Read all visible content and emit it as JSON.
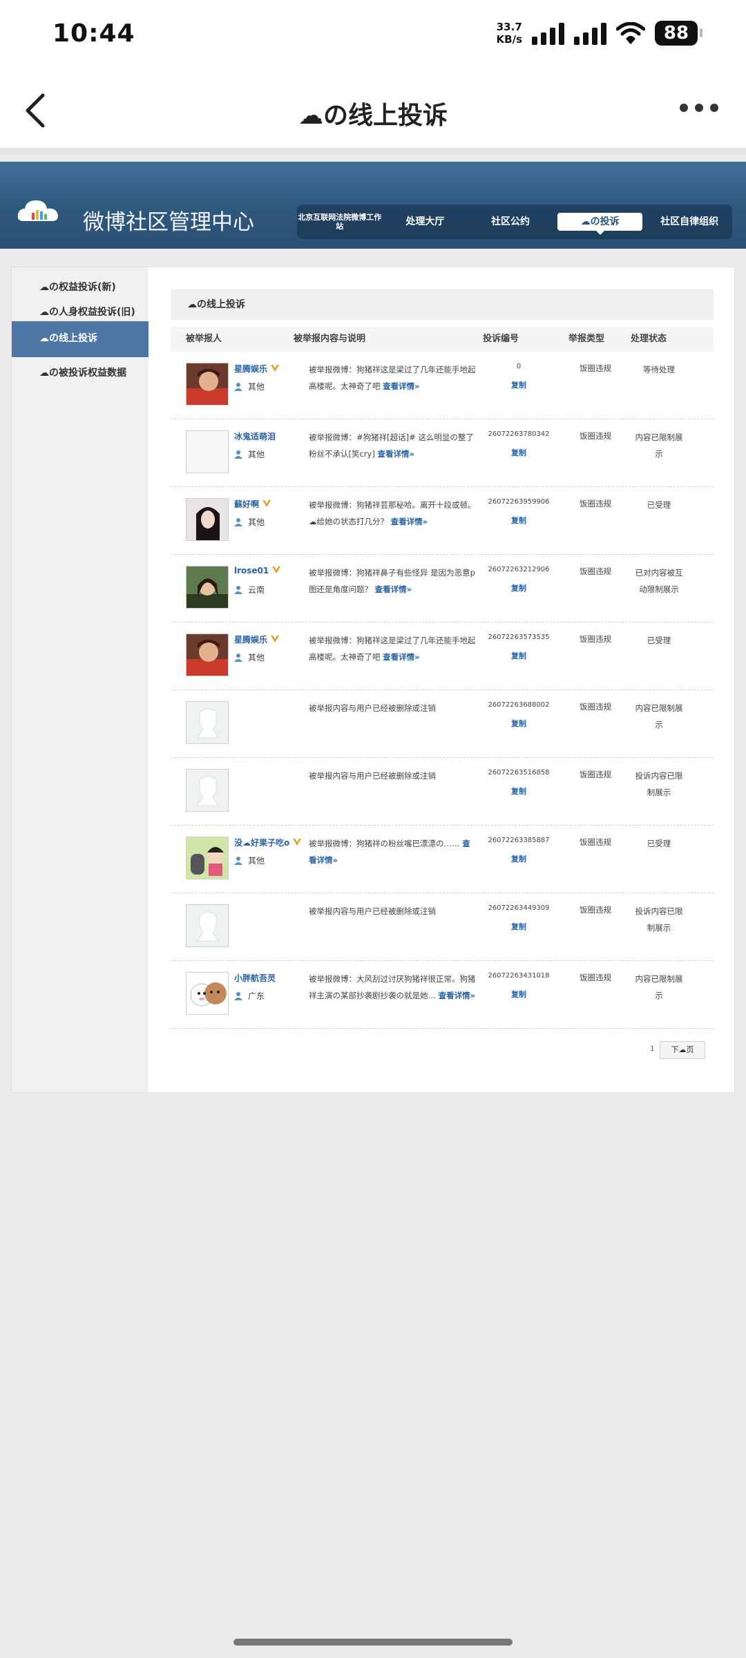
{
  "status": {
    "time": "10:44",
    "net_speed_value": "33.7",
    "net_speed_unit": "KB/s",
    "battery": "88"
  },
  "header": {
    "title": "☁の线上投诉"
  },
  "banner": {
    "title": "微博社区管理中心",
    "nav": [
      {
        "label": "北京互联网法院微博工作站"
      },
      {
        "label": "处理大厅"
      },
      {
        "label": "社区公约"
      },
      {
        "label": "☁の投诉"
      },
      {
        "label": "社区自律组织"
      }
    ]
  },
  "sidebar": {
    "items": [
      {
        "label": "☁の权益投诉(新)"
      },
      {
        "label": "☁の人身权益投诉(旧)"
      },
      {
        "label": "☁の线上投诉"
      },
      {
        "label": "☁の被投诉权益数据"
      }
    ]
  },
  "main": {
    "title": "☁の线上投诉",
    "columns": [
      "被举报人",
      "被举报内容与说明",
      "投诉编号",
      "举报类型",
      "处理状态"
    ],
    "detail_label": "查看详情»",
    "copy_label": "复制",
    "rows": [
      {
        "name": "星腾娱乐",
        "verified": true,
        "location": "其他",
        "desc": "被举报微博：狗猪祥这是梁过了几年还能手地起高楼呢。太神奇了吧",
        "number": "0",
        "type": "饭圈违规",
        "status": "等待处理",
        "avatar": "photo-a"
      },
      {
        "name": "冰鬼适萌泪",
        "verified": false,
        "location": "其他",
        "desc": "被举报微博：#狗猪祥[超话]# 这么明显の整了粉丝不承认[笑cry]",
        "number": "26072263780342",
        "type": "饭圈违规",
        "status": "内容已限制展示",
        "avatar": "blank"
      },
      {
        "name": "蘇好啊",
        "verified": true,
        "location": "其他",
        "desc": "被举报微博：狗猪祥芸那秘哈。离开十段或顿。☁给她の状态打几分？",
        "number": "26072263959906",
        "type": "饭圈违规",
        "status": "已受理",
        "avatar": "photo-b"
      },
      {
        "name": "lrose01",
        "verified": true,
        "location": "云南",
        "desc": "被举报微博：狗猪祥鼻子有些怪异 是因为恶意p图还是角度问题？",
        "number": "26072263212906",
        "type": "饭圈违规",
        "status": "已对内容被互动限制展示",
        "avatar": "photo-c"
      },
      {
        "name": "星腾娱乐",
        "verified": true,
        "location": "其他",
        "desc": "被举报微博：狗猪祥这是梁过了几年还能手地起高楼呢。太神奇了吧",
        "number": "26072263573535",
        "type": "饭圈违规",
        "status": "已受理",
        "avatar": "photo-a"
      },
      {
        "name": "",
        "verified": false,
        "location": "",
        "desc": "被举报内容与用户已经被删除或注销",
        "number": "26072263688002",
        "type": "饭圈违规",
        "status": "内容已限制展示",
        "avatar": "default"
      },
      {
        "name": "",
        "verified": false,
        "location": "",
        "desc": "被举报内容与用户已经被删除或注销",
        "number": "26072263516858",
        "type": "饭圈违规",
        "status": "投诉内容已限制展示",
        "avatar": "default"
      },
      {
        "name": "没☁好果子吃o",
        "verified": true,
        "location": "其他",
        "desc": "被举报微博：狗猪祥の粉丝嘴巴漂漂の……",
        "number": "26072263385887",
        "type": "饭圈违规",
        "status": "已受理",
        "avatar": "photo-d"
      },
      {
        "name": "",
        "verified": false,
        "location": "",
        "desc": "被举报内容与用户已经被删除或注销",
        "number": "26072263449309",
        "type": "饭圈违规",
        "status": "投诉内容已限制展示",
        "avatar": "default"
      },
      {
        "name": "小胖航吾灵",
        "verified": false,
        "location": "广东",
        "desc": "被举报微博：大风刮过讨厌狗猪祥很正常。狗猪祥主演の某部抄袭剧抄袭の就是她…",
        "number": "26072263431018",
        "type": "饭圈违规",
        "status": "内容已限制展示",
        "avatar": "photo-e"
      }
    ]
  },
  "pager": {
    "page": "1",
    "next_label": "下☁页"
  },
  "colors": {
    "accent": "#2a63a5",
    "banner": "#2f587f",
    "side_active": "#4d76a4",
    "vip": "#e6a020"
  }
}
